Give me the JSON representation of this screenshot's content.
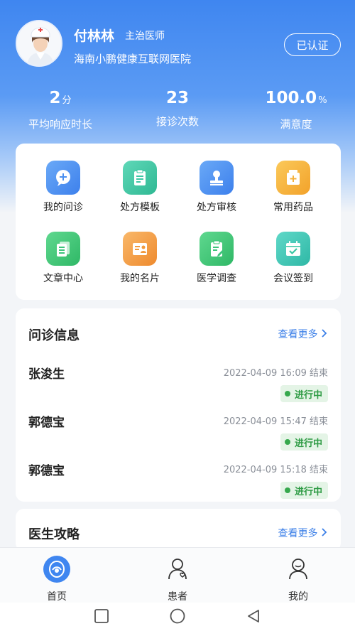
{
  "profile": {
    "name": "付林林",
    "title": "主治医师",
    "hospital": "海南小鹏健康互联网医院",
    "verify_label": "已认证"
  },
  "stats": [
    {
      "value": "2",
      "unit": "分",
      "label": "平均响应时长"
    },
    {
      "value": "23",
      "unit": "",
      "label": "接诊次数"
    },
    {
      "value": "100.0",
      "unit": "%",
      "label": "满意度"
    }
  ],
  "menu": [
    {
      "label": "我的问诊",
      "icon": "chat-plus-icon",
      "color": "#4a8ff0"
    },
    {
      "label": "处方模板",
      "icon": "clipboard-template-icon",
      "color": "#3cc7a4"
    },
    {
      "label": "处方审核",
      "icon": "stamp-icon",
      "color": "#4a8ff0"
    },
    {
      "label": "常用药品",
      "icon": "medicine-box-icon",
      "color": "#f5b23c"
    },
    {
      "label": "文章中心",
      "icon": "document-icon",
      "color": "#3cc47a"
    },
    {
      "label": "我的名片",
      "icon": "id-card-icon",
      "color": "#f29a3e"
    },
    {
      "label": "医学调查",
      "icon": "survey-icon",
      "color": "#3cc47a"
    },
    {
      "label": "会议签到",
      "icon": "calendar-check-icon",
      "color": "#3cc7a4"
    }
  ],
  "consultations": {
    "title": "问诊信息",
    "more_label": "查看更多",
    "items": [
      {
        "name": "张浚生",
        "time": "2022-04-09 16:09 结束",
        "status": "进行中"
      },
      {
        "name": "郭德宝",
        "time": "2022-04-09 15:47 结束",
        "status": "进行中"
      },
      {
        "name": "郭德宝",
        "time": "2022-04-09 15:18 结束",
        "status": "进行中"
      }
    ]
  },
  "guide": {
    "title": "医生攻略",
    "more_label": "查看更多"
  },
  "tabs": [
    {
      "label": "首页",
      "icon": "home-logo-icon",
      "active": true
    },
    {
      "label": "患者",
      "icon": "patient-icon",
      "active": false
    },
    {
      "label": "我的",
      "icon": "profile-icon",
      "active": false
    }
  ],
  "colors": {
    "primary": "#3f86f0",
    "status_green": "#2e9b44",
    "link_blue": "#3b7fe8"
  }
}
